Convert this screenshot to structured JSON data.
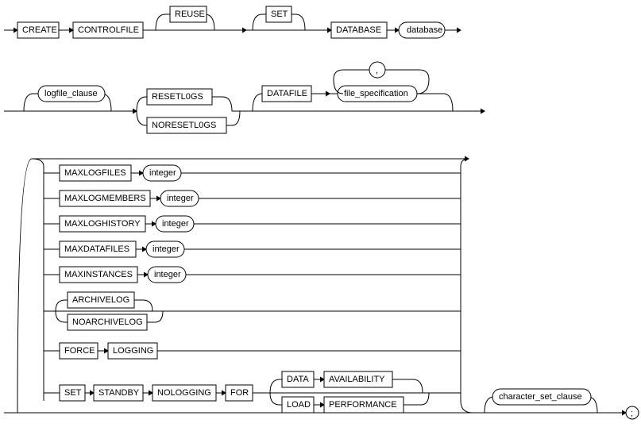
{
  "diagram": {
    "row1": {
      "create": "CREATE",
      "controlfile": "CONTROLFILE",
      "reuse": "REUSE",
      "set": "SET",
      "database": "DATABASE",
      "database_term": "database"
    },
    "row2": {
      "logfile_clause": "logfile_clause",
      "resetlogs": "RESETL0GS",
      "noresetlogs": "NORESETL0GS",
      "datafile": "DATAFILE",
      "file_specification": "file_specification",
      "comma": ","
    },
    "options": {
      "maxlogfiles": "MAXLOGFILES",
      "maxlogmembers": "MAXLOGMEMBERS",
      "maxloghistory": "MAXLOGHISTORY",
      "maxdatafiles": "MAXDATAFILES",
      "maxinstances": "MAXINSTANCES",
      "integer": "integer",
      "archivelog": "ARCHIVELOG",
      "noarchivelog": "NOARCHIVELOG",
      "force": "FORCE",
      "logging": "LOGGING",
      "set": "SET",
      "standby": "STANDBY",
      "nologging": "NOLOGGING",
      "for": "FOR",
      "data": "DATA",
      "availability": "AVAILABILITY",
      "load": "LOAD",
      "performance": "PERFORMANCE"
    },
    "tail": {
      "character_set_clause": "character_set_clause",
      "semicolon": ";"
    }
  }
}
